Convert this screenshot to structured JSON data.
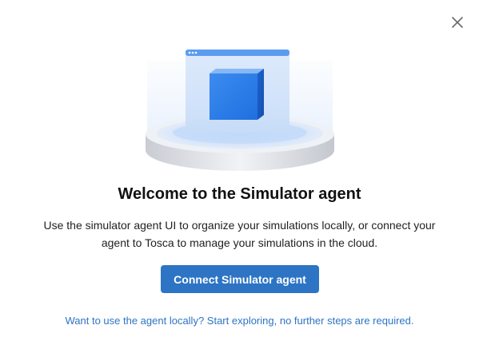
{
  "dialog": {
    "title": "Welcome to the Simulator agent",
    "description_line1": "Use the simulator agent UI to organize your simulations locally, or connect your",
    "description_line2": "agent to Tosca to manage your simulations in the cloud.",
    "connect_button_label": "Connect Simulator agent",
    "local_link_text": "Want to use the agent locally? Start exploring, no further steps are required.",
    "close_icon": "close-icon",
    "hero_icon": "cube-on-pedestal-illustration"
  },
  "colors": {
    "accent": "#2d74c4",
    "title": "#111111",
    "cube_front": "#2f7fe8",
    "cube_top": "#7fb4f4"
  }
}
